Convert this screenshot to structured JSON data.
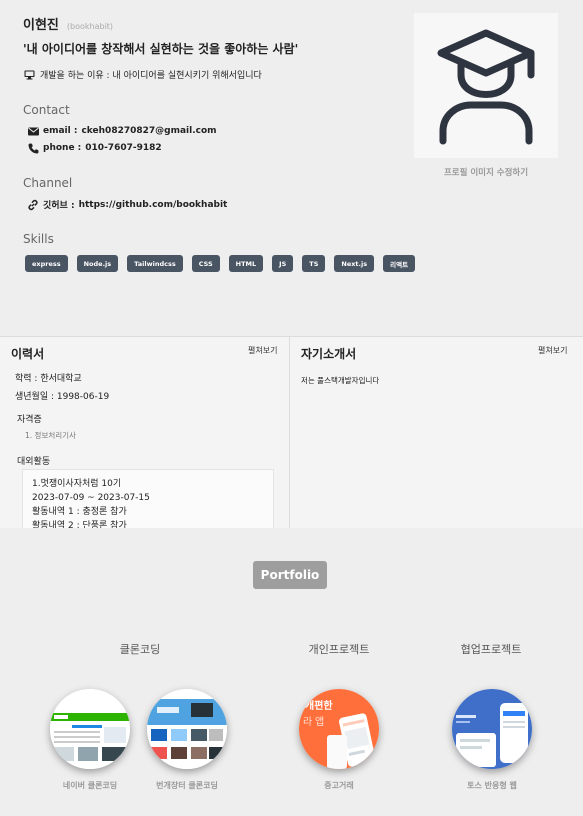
{
  "profile": {
    "name": "이현진",
    "nickname": "(bookhabit)",
    "motto": "'내 아이디어를 창작해서 실현하는 것을 좋아하는 사람'",
    "reason": "개발을 하는 이유 : 내 아이디어를 실현시키기 위해서입니다",
    "contact_label": "Contact",
    "email_key": "email :",
    "email_value": "ckeh08270827@gmail.com",
    "phone_key": "phone :",
    "phone_value": "010-7607-9182",
    "channel_label": "Channel",
    "github_key": "깃허브 :",
    "github_value": "https://github.com/bookhabit",
    "skills_label": "Skills",
    "skills": [
      "express",
      "Node.js",
      "Tailwindcss",
      "CSS",
      "HTML",
      "JS",
      "TS",
      "Next.js",
      "리액트"
    ],
    "avatar_edit": "프로필 이미지 수정하기",
    "colors": {
      "chip": "#4a5563",
      "avatar_icon": "#2e3440"
    }
  },
  "resume": {
    "title": "이력서",
    "toggle": "펼쳐보기",
    "education": "학력 : 한서대학교",
    "birth": "생년월일 : 1998-06-19",
    "cert_label": "자격증",
    "cert_items": [
      "1. 정보처리기사"
    ],
    "activity_label": "대외활동",
    "activity_lines": [
      "1.멋쟁이사자처럼 10기",
      "2023-07-09 ~ 2023-07-15",
      "활동내역 1 : 충정론 참가",
      "활동내역 2 : 단풍론 참가"
    ]
  },
  "intro": {
    "title": "자기소개서",
    "toggle": "펼쳐보기",
    "text": "저는 풀스택개발자입니다"
  },
  "portfolio": {
    "title": "Portfolio",
    "categories": [
      "클론코딩",
      "개인프로젝트",
      "협업프로젝트"
    ],
    "projects": [
      {
        "label": "네이버 클론코딩",
        "thumb_text": ""
      },
      {
        "label": "번개장터 클론코딩",
        "thumb_text": ""
      },
      {
        "label": "중고거래",
        "thumb_text": "개편한\n라 앱"
      },
      {
        "label": "토스 반응형 웹",
        "thumb_text": ""
      }
    ]
  }
}
